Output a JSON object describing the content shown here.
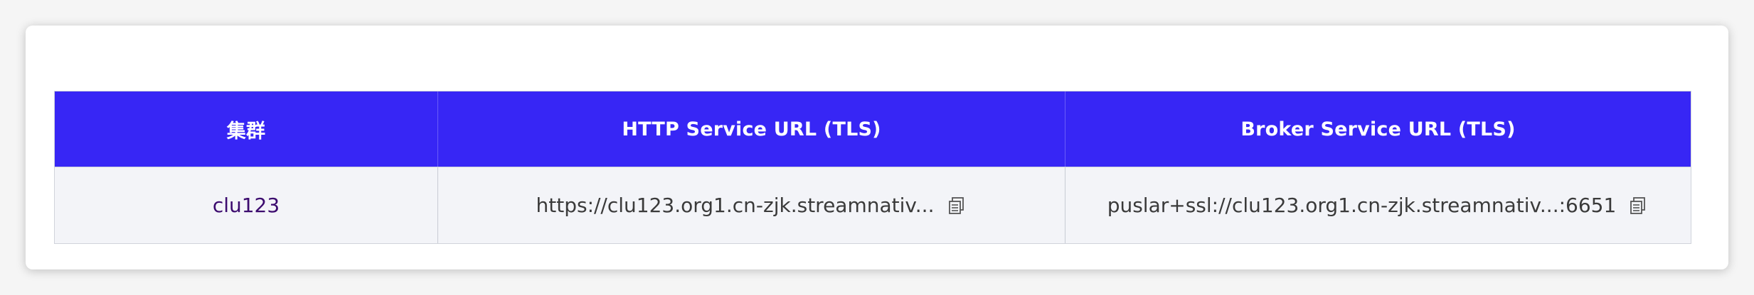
{
  "table": {
    "headers": [
      "集群",
      "HTTP Service URL (TLS)",
      "Broker Service URL (TLS)"
    ],
    "rows": [
      {
        "cluster": "clu123",
        "http_url": "https://clu123.org1.cn-zjk.streamnativ...",
        "broker_url": "puslar+ssl://clu123.org1.cn-zjk.streamnativ...:6651"
      }
    ]
  },
  "colors": {
    "header_bg": "#3726f5",
    "row_bg": "#f3f4f8",
    "cluster_text": "#3b0a6e"
  },
  "icons": {
    "copy": "copy-icon"
  }
}
